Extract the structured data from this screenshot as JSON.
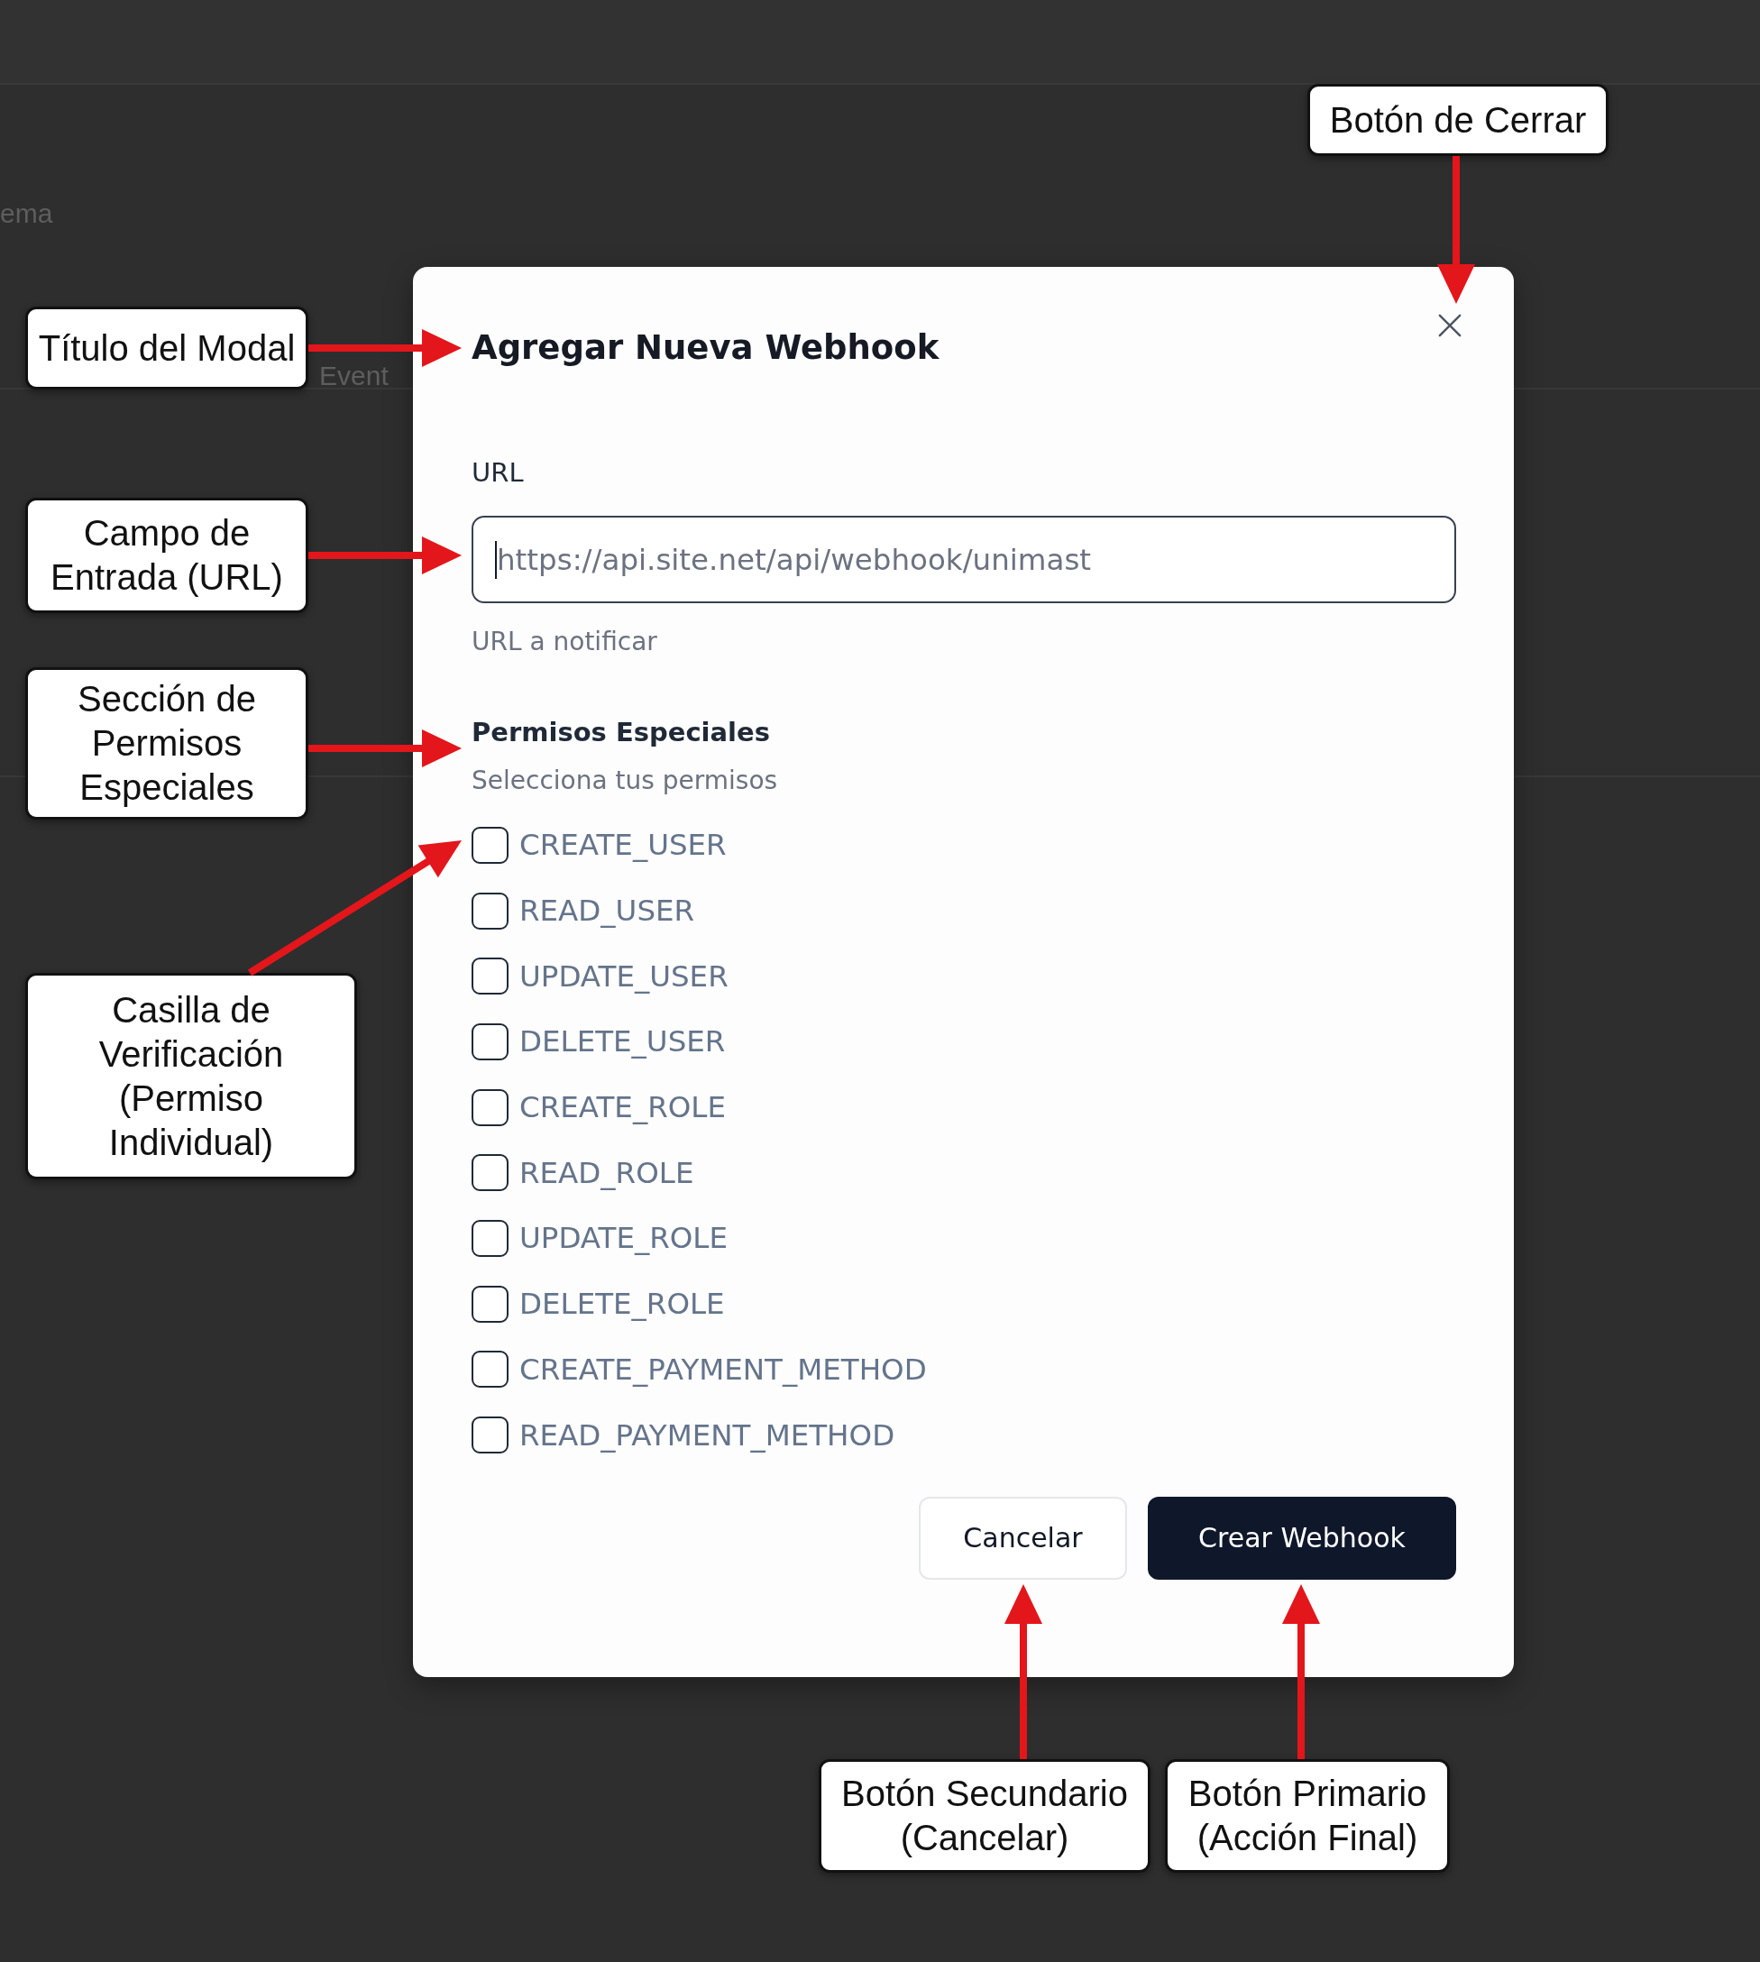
{
  "background": {
    "texts": [
      "ema",
      "Event"
    ]
  },
  "modal": {
    "title": "Agregar Nueva Webhook",
    "url_field": {
      "label": "URL",
      "placeholder": "https://api.site.net/api/webhook/unimast",
      "focused": true,
      "help": "URL a notificar"
    },
    "permissions": {
      "title": "Permisos Especiales",
      "subtitle": "Selecciona tus permisos",
      "items": [
        {
          "label": "CREATE_USER",
          "checked": false
        },
        {
          "label": "READ_USER",
          "checked": false
        },
        {
          "label": "UPDATE_USER",
          "checked": false
        },
        {
          "label": "DELETE_USER",
          "checked": false
        },
        {
          "label": "CREATE_ROLE",
          "checked": false
        },
        {
          "label": "READ_ROLE",
          "checked": false
        },
        {
          "label": "UPDATE_ROLE",
          "checked": false
        },
        {
          "label": "DELETE_ROLE",
          "checked": false
        },
        {
          "label": "CREATE_PAYMENT_METHOD",
          "checked": false
        },
        {
          "label": "READ_PAYMENT_METHOD",
          "checked": false
        }
      ]
    },
    "buttons": [
      {
        "label": "Cancelar",
        "kind": "secondary"
      },
      {
        "label": "Crear Webhook",
        "kind": "primary"
      }
    ]
  },
  "callouts": [
    {
      "text": "Botón de Cerrar"
    },
    {
      "text": "Título del Modal"
    },
    {
      "text": "Campo de\nEntrada (URL)"
    },
    {
      "text": "Sección de\nPermisos\nEspeciales"
    },
    {
      "text": "Casilla de\nVerificación\n(Permiso\nIndividual)"
    },
    {
      "text": "Botón Secundario\n(Cancelar)"
    },
    {
      "text": "Botón Primario\n(Acción Final)"
    }
  ]
}
